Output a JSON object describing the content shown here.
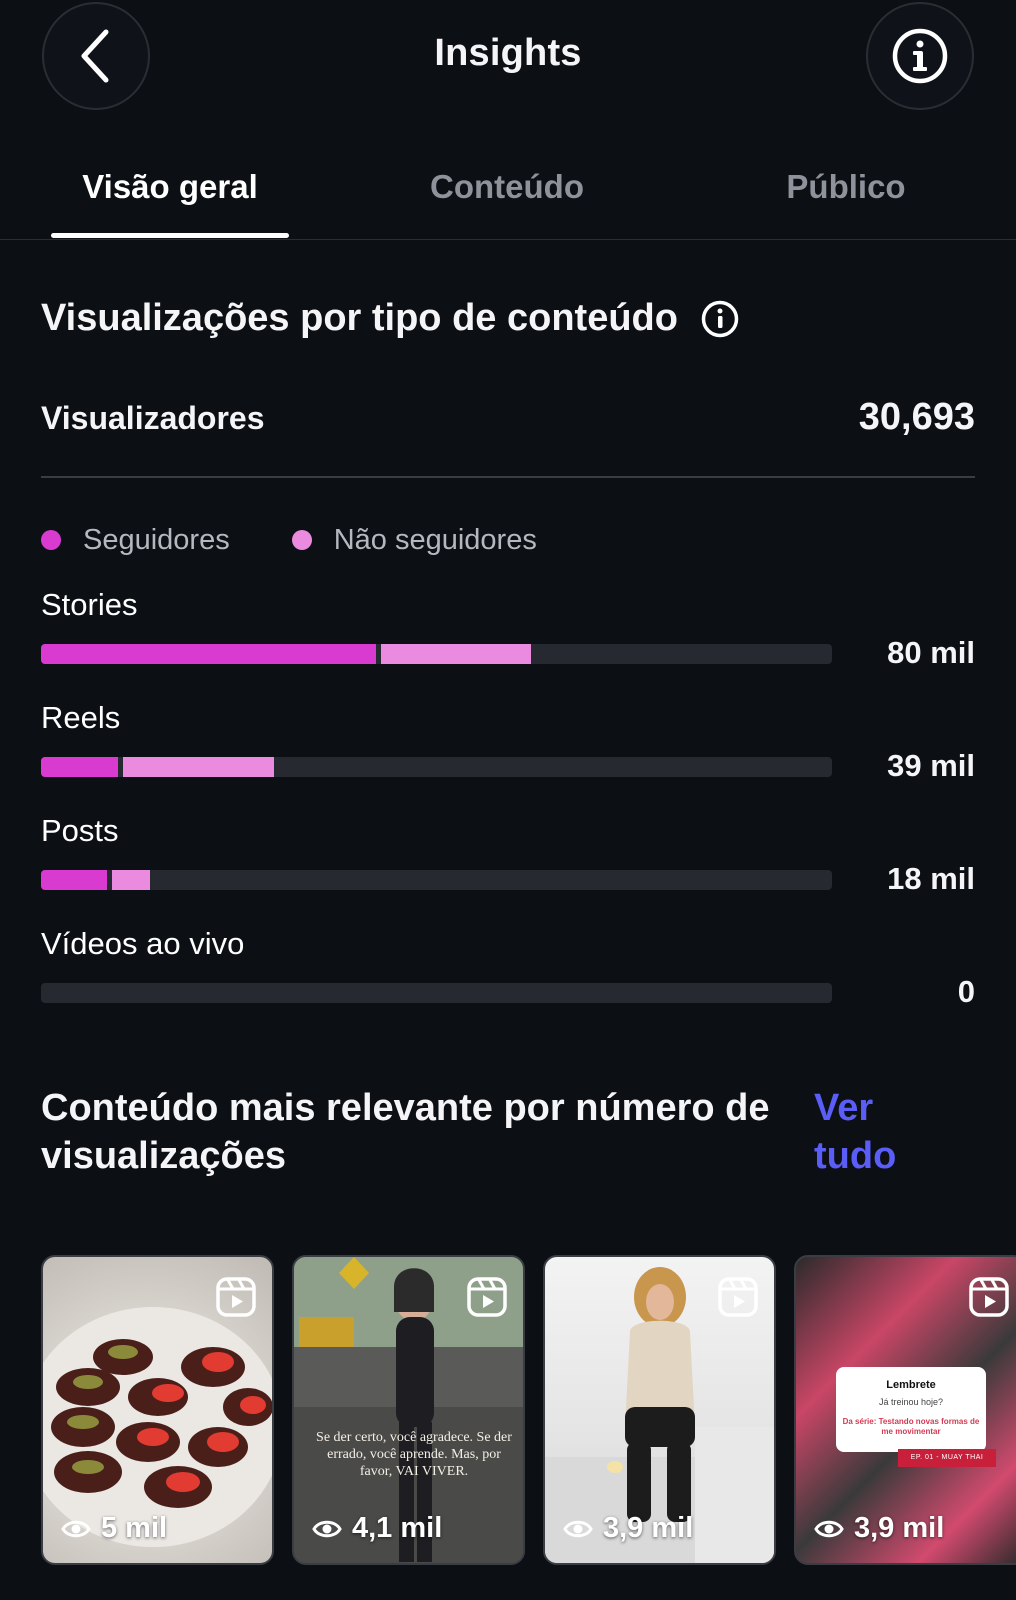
{
  "header": {
    "title": "Insights",
    "back_icon": "chevron-left-icon",
    "info_icon": "info-icon"
  },
  "tabs": [
    {
      "label": "Visão geral",
      "active": true
    },
    {
      "label": "Conteúdo",
      "active": false
    },
    {
      "label": "Público",
      "active": false
    }
  ],
  "views_by_type": {
    "title": "Visualizações por tipo de conteúdo",
    "viewers_label": "Visualizadores",
    "viewers_value": "30,693",
    "legend": [
      {
        "label": "Seguidores",
        "color": "#d93bd0"
      },
      {
        "label": "Não seguidores",
        "color": "#ea8bdf"
      }
    ],
    "bars": [
      {
        "label": "Stories",
        "value_text": "80 mil",
        "followers_fraction": 0.423,
        "nonfollowers_fraction": 0.19
      },
      {
        "label": "Reels",
        "value_text": "39 mil",
        "followers_fraction": 0.097,
        "nonfollowers_fraction": 0.191
      },
      {
        "label": "Posts",
        "value_text": "18 mil",
        "followers_fraction": 0.083,
        "nonfollowers_fraction": 0.048
      },
      {
        "label": "Vídeos ao vivo",
        "value_text": "0",
        "followers_fraction": 0,
        "nonfollowers_fraction": 0
      }
    ]
  },
  "top_content": {
    "title": "Conteúdo mais relevante por número de visualizações",
    "see_all": "Ver tudo",
    "items": [
      {
        "views": "5 mil",
        "type_icon": "reel-icon"
      },
      {
        "views": "4,1 mil",
        "type_icon": "reel-icon",
        "caption": "Se der certo, você agradece. Se der errado, você aprende. Mas, por favor, VAI VIVER."
      },
      {
        "views": "3,9 mil",
        "type_icon": "reel-icon"
      },
      {
        "views": "3,9 mil",
        "type_icon": "reel-icon",
        "note_title": "Lembrete",
        "note_question": "Já treinou hoje?",
        "note_series": "Da série: Testando novas formas de me movimentar",
        "note_tag": "EP. 01 - MUAY THAI"
      }
    ]
  }
}
